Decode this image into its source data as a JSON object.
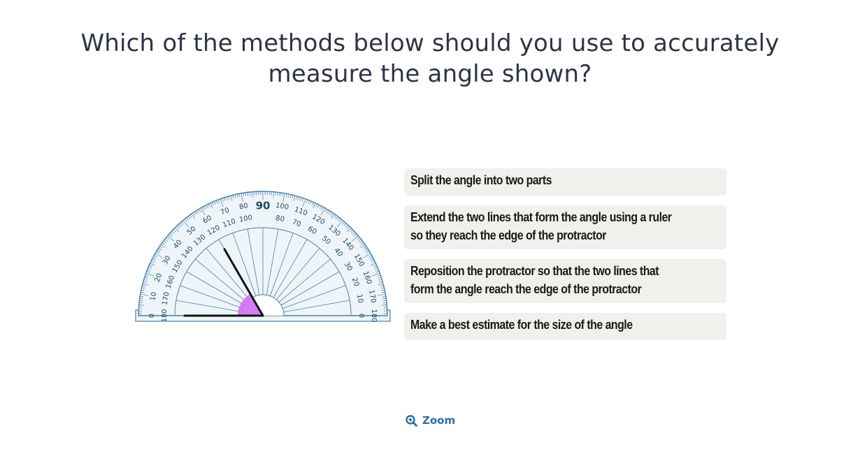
{
  "question": {
    "text": "Which of the methods below should you use to accurately measure the angle shown?"
  },
  "protractor": {
    "outer_scale": [
      "0",
      "10",
      "20",
      "30",
      "40",
      "50",
      "60",
      "70",
      "80",
      "90",
      "100",
      "110",
      "120",
      "130",
      "140",
      "150",
      "160",
      "170",
      "180"
    ],
    "inner_scale": [
      "180",
      "170",
      "160",
      "150",
      "140",
      "130",
      "120",
      "110",
      "100",
      "90",
      "80",
      "70",
      "60",
      "50",
      "40",
      "30",
      "20",
      "10",
      "0"
    ],
    "center_label": "90",
    "angle_degrees": 60,
    "colors": {
      "outline": "#4a7fa8",
      "face": "#eef5f9",
      "angle_fill": "#d46ef5",
      "lines": "#111111",
      "text": "#234a66"
    }
  },
  "options": [
    {
      "text": "Split the angle into two parts"
    },
    {
      "text": "Extend the two lines that form the angle using a ruler\nso they reach the edge of the protractor"
    },
    {
      "text": "Reposition the protractor so that the two lines that\nform the angle reach the edge of the protractor"
    },
    {
      "text": "Make a best estimate for the size of the angle"
    }
  ],
  "zoom": {
    "label": "Zoom",
    "icon": "zoom-in-icon"
  }
}
